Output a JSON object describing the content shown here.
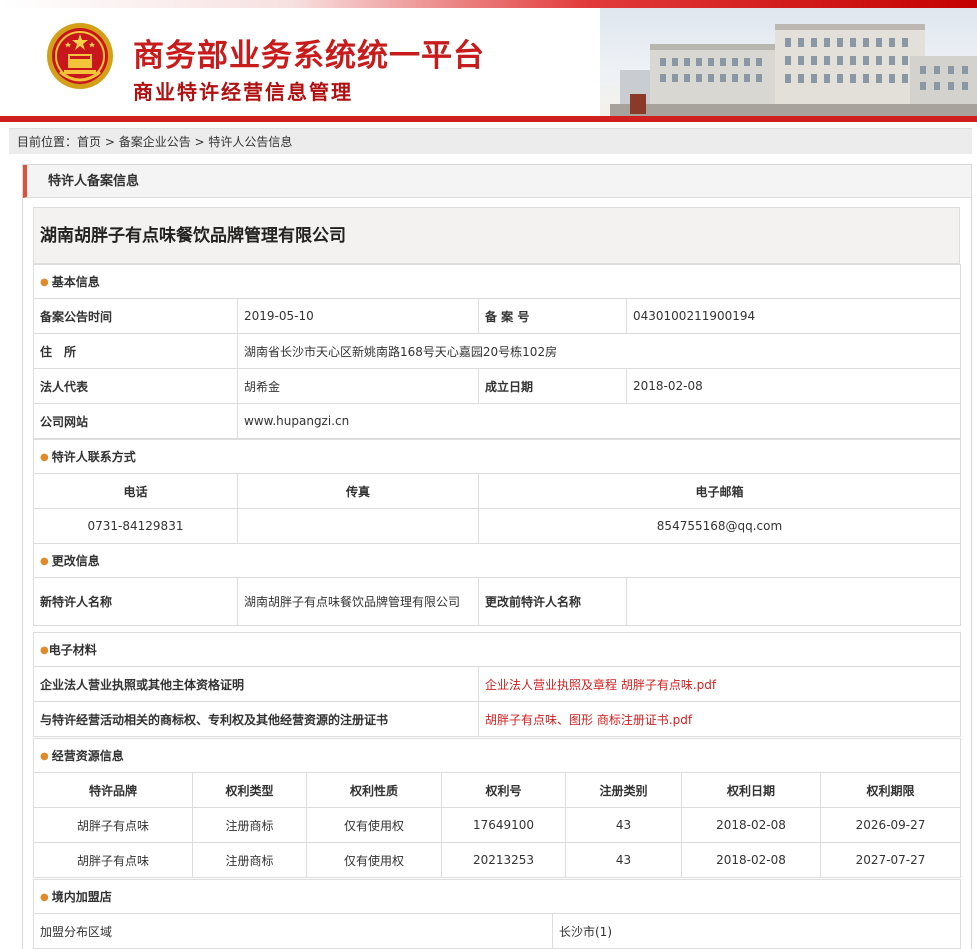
{
  "header": {
    "title": "商务部业务系统统一平台",
    "subtitle": "商业特许经营信息管理"
  },
  "breadcrumb": {
    "prefix": "目前位置：",
    "items": [
      "首页",
      "备案企业公告",
      "特许人公告信息"
    ],
    "separator": " > "
  },
  "panel": {
    "title": "特许人备案信息"
  },
  "company": {
    "name": "湖南胡胖子有点味餐饮品牌管理有限公司"
  },
  "basic": {
    "section": "基本信息",
    "filing_date_label": "备案公告时间",
    "filing_date": "2019-05-10",
    "filing_no_label": "备 案 号",
    "filing_no": "0430100211900194",
    "address_label": "住　所",
    "address": "湖南省长沙市天心区新姚南路168号天心嘉园20号栋102房",
    "legal_rep_label": "法人代表",
    "legal_rep": "胡希金",
    "established_label": "成立日期",
    "established": "2018-02-08",
    "website_label": "公司网站",
    "website": "www.hupangzi.cn"
  },
  "contact": {
    "section": "特许人联系方式",
    "phone_label": "电话",
    "fax_label": "传真",
    "email_label": "电子邮箱",
    "phone": "0731-84129831",
    "fax": "",
    "email": "854755168@qq.com"
  },
  "change": {
    "section": "更改信息",
    "new_name_label": "新特许人名称",
    "new_name": "湖南胡胖子有点味餐饮品牌管理有限公司",
    "old_name_label": "更改前特许人名称",
    "old_name": ""
  },
  "materials": {
    "section": "电子材料",
    "rows": [
      {
        "label": "企业法人营业执照或其他主体资格证明",
        "file": "企业法人营业执照及章程 胡胖子有点味.pdf"
      },
      {
        "label": "与特许经营活动相关的商标权、专利权及其他经营资源的注册证书",
        "file": "胡胖子有点味、图形 商标注册证书.pdf"
      }
    ]
  },
  "resources": {
    "section": "经营资源信息",
    "headers": [
      "特许品牌",
      "权利类型",
      "权利性质",
      "权利号",
      "注册类别",
      "权利日期",
      "权利期限"
    ],
    "rows": [
      [
        "胡胖子有点味",
        "注册商标",
        "仅有使用权",
        "17649100",
        "43",
        "2018-02-08",
        "2026-09-27"
      ],
      [
        "胡胖子有点味",
        "注册商标",
        "仅有使用权",
        "20213253",
        "43",
        "2018-02-08",
        "2027-07-27"
      ]
    ]
  },
  "stores": {
    "section": "境内加盟店",
    "region_label": "加盟分布区域",
    "region_value": "长沙市(1)"
  },
  "colors": {
    "brand_red": "#c81b1b",
    "accent_orange": "#e08a2c",
    "link_red": "#d11f1f"
  }
}
